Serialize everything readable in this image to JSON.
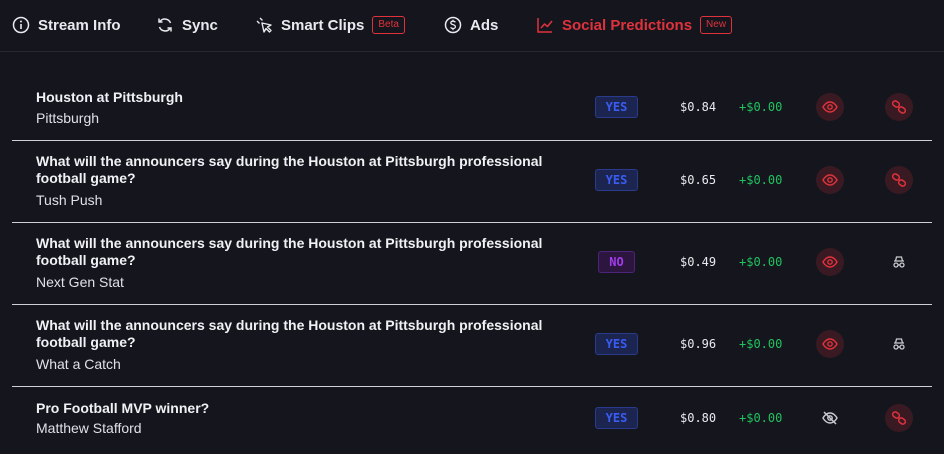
{
  "tabs": [
    {
      "label": "Stream Info",
      "icon": "info-circle-icon"
    },
    {
      "label": "Sync",
      "icon": "refresh-icon"
    },
    {
      "label": "Smart Clips",
      "icon": "clip-cursor-icon",
      "tag": "Beta"
    },
    {
      "label": "Ads",
      "icon": "dollar-circle-icon"
    },
    {
      "label": "Social Predictions",
      "icon": "line-chart-icon",
      "tag": "New",
      "active": true
    }
  ],
  "colors": {
    "background": "#15161d",
    "accent": "#e0323c",
    "yes": "#3a5cf2",
    "no": "#a23ce8",
    "gain": "#21c25e"
  },
  "rows": [
    {
      "question": "Houston at Pittsburgh",
      "answer": "Pittsburgh",
      "outcome": "YES",
      "price": "$0.84",
      "change": "+$0.00",
      "visibility_icon": "eye-icon",
      "action_icon": "link-icon"
    },
    {
      "question": "What will the announcers say during the Houston at Pittsburgh professional football game?",
      "answer": "Tush Push",
      "outcome": "YES",
      "price": "$0.65",
      "change": "+$0.00",
      "visibility_icon": "eye-icon",
      "action_icon": "link-icon"
    },
    {
      "question": "What will the announcers say during the Houston at Pittsburgh professional football game?",
      "answer": "Next Gen Stat",
      "outcome": "NO",
      "price": "$0.49",
      "change": "+$0.00",
      "visibility_icon": "eye-icon",
      "action_icon": "incognito-icon"
    },
    {
      "question": "What will the announcers say during the Houston at Pittsburgh professional football game?",
      "answer": "What a Catch",
      "outcome": "YES",
      "price": "$0.96",
      "change": "+$0.00",
      "visibility_icon": "eye-icon",
      "action_icon": "incognito-icon"
    },
    {
      "question": "Pro Football MVP winner?",
      "answer": "Matthew Stafford",
      "outcome": "YES",
      "price": "$0.80",
      "change": "+$0.00",
      "visibility_icon": "eye-off-icon",
      "action_icon": "link-icon"
    }
  ]
}
